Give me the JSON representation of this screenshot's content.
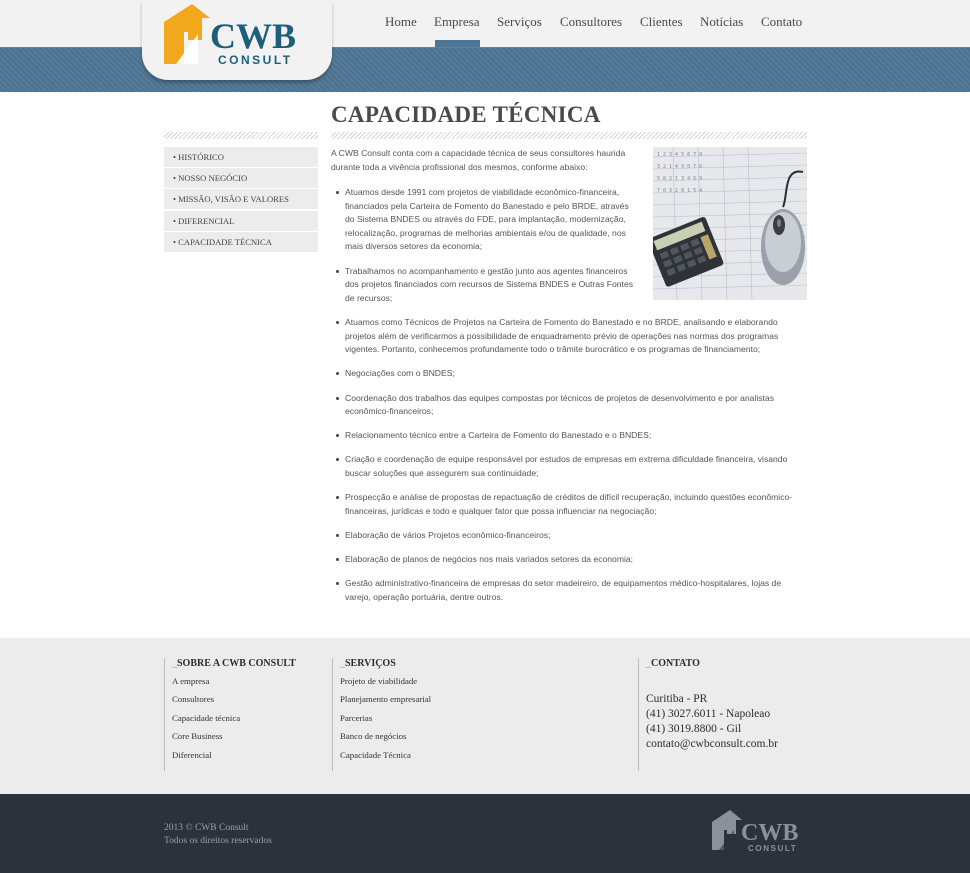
{
  "brand": {
    "logo_main": "CWB",
    "logo_sub": "CONSULT",
    "colors": {
      "blue": "#1d5f7a",
      "orange": "#f2a81d",
      "band": "#4f7694",
      "footer": "#2b323b"
    }
  },
  "nav": {
    "items": [
      "Home",
      "Empresa",
      "Serviços",
      "Consultores",
      "Clientes",
      "Notícias",
      "Contato"
    ],
    "active": "Empresa"
  },
  "sidebar": {
    "items": [
      "• HISTÓRICO",
      "• NOSSO NEGÓCIO",
      "• MISSÃO, VISÃO E VALORES",
      "• DIFERENCIAL",
      "• CAPACIDADE TÉCNICA"
    ]
  },
  "main": {
    "title": "CAPACIDADE TÉCNICA",
    "intro": "A CWB Consult conta com a capacidade técnica de seus consultores haurida durante toda a vivência profissional dos mesmos, conforme abaixo:",
    "image_icon": "calculator-mouse-image",
    "bullets": [
      "Atuamos desde 1991 com projetos de viabilidade econômico-financeira, financiados pela Carteira de Fomento do Banestado e pelo BRDE, através do Sistema BNDES ou através do FDE, para implantação, modernização, relocalização, programas de melhorias ambientais e/ou de qualidade, nos mais diversos setores da economia;",
      "Trabalhamos no acompanhamento e gestão junto aos agentes financeiros dos projetos financiados com recursos de Sistema BNDES e Outras Fontes de recursos;",
      "Atuamos como Técnicos de Projetos na Carteira de Fomento do Banestado e no BRDE, analisando e elaborando projetos além de verificarmos a possibilidade de enquadramento prévio de operações nas normas dos programas vigentes. Portanto, conhecemos profundamente todo o trâmite burocrático e os programas de financiamento;",
      "Negociações com o BNDES;",
      "Coordenação dos trabalhos das equipes compostas por técnicos de projetos de desenvolvimento e por analistas econômico-financeiros;",
      "Relacionamento técnico entre a Carteira de Fomento do Banestado e o BNDES;",
      "Criação e coordenação de equipe responsável por estudos de empresas em extrema dificuldade financeira, visando buscar soluções que assegurem sua continuidade;",
      "Prospecção e análise de propostas de repactuação de créditos de difícil recuperação, incluindo questões econômico-financeiras, jurídicas e todo e qualquer fator que possa influenciar na negociação;",
      "Elaboração de vários Projetos econômico-financeiros;",
      "Elaboração de planos de negócios nos mais variados setores da economia;",
      "Gestão administrativo-financeira de empresas do setor madeireiro, de equipamentos médico-hospitalares, lojas de varejo, operação portuária, dentre outros."
    ]
  },
  "footer": {
    "about": {
      "prefix": "_",
      "title": "SOBRE A CWB CONSULT",
      "links": [
        "A empresa",
        "Consultores",
        "Capacidade técnica",
        "Core Business",
        "Diferencial"
      ]
    },
    "services": {
      "prefix": "_",
      "title": "SERVIÇOS",
      "links": [
        "Projeto de viabilidade",
        "Planejamento empresarial",
        "Parcerias",
        "Banco de negócios",
        "Capacidade Técnica"
      ]
    },
    "contact": {
      "prefix": "_",
      "title": "CONTATO",
      "lines": [
        "Curitiba - PR",
        "(41) 3027.6011 - Napoleao",
        "(41) 3019.8800 - Gil",
        "contato@cwbconsult.com.br"
      ]
    }
  },
  "bottom": {
    "copyright": "2013 © CWB Consult",
    "rights": "Todos os direitos reservados",
    "logo_main": "CWB",
    "logo_sub": "CONSULT"
  }
}
